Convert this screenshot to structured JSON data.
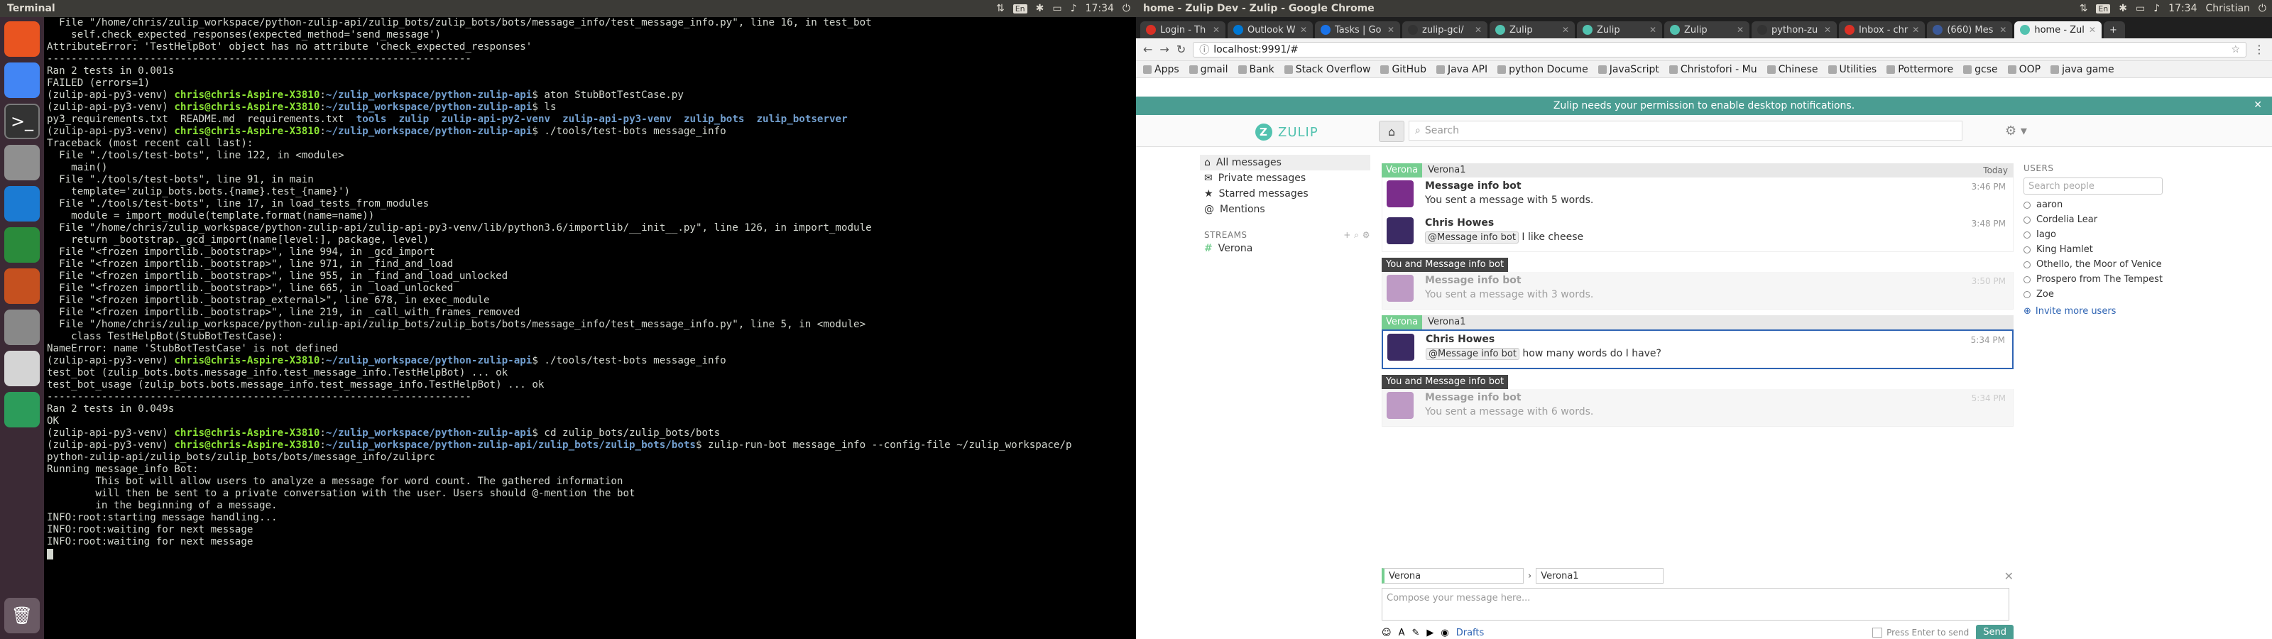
{
  "left_screen": {
    "topbar": {
      "title": "Terminal",
      "time": "17:34",
      "icons": [
        "network-icon",
        "keyboard-icon",
        "bluetooth-icon",
        "battery-icon",
        "volume-icon"
      ],
      "keyboard_label": "En"
    },
    "launcher": [
      {
        "name": "dash-icon",
        "color": "#e95420"
      },
      {
        "name": "chrome-icon",
        "color": "#4285f4"
      },
      {
        "name": "terminal-icon",
        "color": "#333333"
      },
      {
        "name": "files-icon",
        "color": "#8f8f8f"
      },
      {
        "name": "writer-icon",
        "color": "#1b7bd3"
      },
      {
        "name": "calc-icon",
        "color": "#2a8b3b"
      },
      {
        "name": "impress-icon",
        "color": "#c5501f"
      },
      {
        "name": "settings-icon",
        "color": "#888888"
      },
      {
        "name": "app-icon",
        "color": "#d4d4d4"
      },
      {
        "name": "green-app-icon",
        "color": "#2c9c5a"
      }
    ],
    "terminal_lines": [
      {
        "t": "  File \"/home/chris/zulip_workspace/python-zulip-api/zulip_bots/zulip_bots/bots/message_info/test_message_info.py\", line 16, in test_bot"
      },
      {
        "t": "    self.check_expected_responses(expected_method='send_message')"
      },
      {
        "t": "AttributeError: 'TestHelpBot' object has no attribute 'check_expected_responses'"
      },
      {
        "t": ""
      },
      {
        "t": "----------------------------------------------------------------------"
      },
      {
        "t": "Ran 2 tests in 0.001s"
      },
      {
        "t": ""
      },
      {
        "t": "FAILED (errors=1)"
      },
      {
        "p": "(zulip-api-py3-venv) ",
        "u": "chris@chris-Aspire-X3810",
        "c": ":",
        "d": "~/zulip_workspace/python-zulip-api",
        "cmd": "$ aton StubBotTestCase.py"
      },
      {
        "p": "(zulip-api-py3-venv) ",
        "u": "chris@chris-Aspire-X3810",
        "c": ":",
        "d": "~/zulip_workspace/python-zulip-api",
        "cmd": "$ ls"
      },
      {
        "t": "py3_requirements.txt  README.md  requirements.txt  tools  zulip  zulip-api-py2-venv  zulip-api-py3-venv  zulip_bots  zulip_botserver"
      },
      {
        "p": "(zulip-api-py3-venv) ",
        "u": "chris@chris-Aspire-X3810",
        "c": ":",
        "d": "~/zulip_workspace/python-zulip-api",
        "cmd": "$ ./tools/test-bots message_info"
      },
      {
        "t": "Traceback (most recent call last):"
      },
      {
        "t": "  File \"./tools/test-bots\", line 122, in <module>"
      },
      {
        "t": "    main()"
      },
      {
        "t": "  File \"./tools/test-bots\", line 91, in main"
      },
      {
        "t": "    template='zulip_bots.bots.{name}.test_{name}')"
      },
      {
        "t": "  File \"./tools/test-bots\", line 17, in load_tests_from_modules"
      },
      {
        "t": "    module = import_module(template.format(name=name))"
      },
      {
        "t": "  File \"/home/chris/zulip_workspace/python-zulip-api/zulip-api-py3-venv/lib/python3.6/importlib/__init__.py\", line 126, in import_module"
      },
      {
        "t": "    return _bootstrap._gcd_import(name[level:], package, level)"
      },
      {
        "t": "  File \"<frozen importlib._bootstrap>\", line 994, in _gcd_import"
      },
      {
        "t": "  File \"<frozen importlib._bootstrap>\", line 971, in _find_and_load"
      },
      {
        "t": "  File \"<frozen importlib._bootstrap>\", line 955, in _find_and_load_unlocked"
      },
      {
        "t": "  File \"<frozen importlib._bootstrap>\", line 665, in _load_unlocked"
      },
      {
        "t": "  File \"<frozen importlib._bootstrap_external>\", line 678, in exec_module"
      },
      {
        "t": "  File \"<frozen importlib._bootstrap>\", line 219, in _call_with_frames_removed"
      },
      {
        "t": "  File \"/home/chris/zulip_workspace/python-zulip-api/zulip_bots/zulip_bots/bots/message_info/test_message_info.py\", line 5, in <module>"
      },
      {
        "t": "    class TestHelpBot(StubBotTestCase):"
      },
      {
        "t": "NameError: name 'StubBotTestCase' is not defined"
      },
      {
        "p": "(zulip-api-py3-venv) ",
        "u": "chris@chris-Aspire-X3810",
        "c": ":",
        "d": "~/zulip_workspace/python-zulip-api",
        "cmd": "$ ./tools/test-bots message_info"
      },
      {
        "t": "test_bot (zulip_bots.bots.message_info.test_message_info.TestHelpBot) ... ok"
      },
      {
        "t": "test_bot_usage (zulip_bots.bots.message_info.test_message_info.TestHelpBot) ... ok"
      },
      {
        "t": ""
      },
      {
        "t": "----------------------------------------------------------------------"
      },
      {
        "t": "Ran 2 tests in 0.049s"
      },
      {
        "t": ""
      },
      {
        "t": "OK"
      },
      {
        "p": "(zulip-api-py3-venv) ",
        "u": "chris@chris-Aspire-X3810",
        "c": ":",
        "d": "~/zulip_workspace/python-zulip-api",
        "cmd": "$ cd zulip_bots/zulip_bots/bots"
      },
      {
        "p": "(zulip-api-py3-venv) ",
        "u": "chris@chris-Aspire-X3810",
        "c": ":",
        "d": "~/zulip_workspace/python-zulip-api/zulip_bots/zulip_bots/bots",
        "cmd": "$ zulip-run-bot message_info --config-file ~/zulip_workspace/p"
      },
      {
        "t": "python-zulip-api/zulip_bots/zulip_bots/bots/message_info/zuliprc"
      },
      {
        "t": "Running message_info Bot:"
      },
      {
        "t": ""
      },
      {
        "t": "        This bot will allow users to analyze a message for word count. The gathered information"
      },
      {
        "t": "        will then be sent to a private conversation with the user. Users should @-mention the bot"
      },
      {
        "t": "        in the beginning of a message."
      },
      {
        "t": ""
      },
      {
        "t": "INFO:root:starting message handling..."
      },
      {
        "t": "INFO:root:waiting for next message"
      },
      {
        "t": "INFO:root:waiting for next message"
      }
    ]
  },
  "right_screen": {
    "topbar": {
      "title": "home - Zulip Dev - Zulip - Google Chrome",
      "time": "17:34",
      "user": "Christian",
      "keyboard_label": "En"
    },
    "tabs": [
      {
        "label": "Login - Th",
        "color": "#d93025"
      },
      {
        "label": "Outlook W",
        "color": "#0078d4"
      },
      {
        "label": "Tasks | Go",
        "color": "#1a73e8"
      },
      {
        "label": "zulip-gci/",
        "color": "#333333"
      },
      {
        "label": "Zulip",
        "color": "#52c2af"
      },
      {
        "label": "Zulip",
        "color": "#52c2af"
      },
      {
        "label": "Zulip",
        "color": "#52c2af"
      },
      {
        "label": "python-zu",
        "color": "#333333"
      },
      {
        "label": "Inbox - chr",
        "color": "#d93025"
      },
      {
        "label": "(660) Mes",
        "color": "#3b5998"
      },
      {
        "label": "home - Zul",
        "color": "#52c2af",
        "active": true
      }
    ],
    "url": "localhost:9991/#",
    "bookmarks": [
      "Apps",
      "gmail",
      "Bank",
      "Stack Overflow",
      "GitHub",
      "Java API",
      "python Docume",
      "JavaScript",
      "Christofori - Mu",
      "Chinese",
      "Utilities",
      "Pottermore",
      "gcse",
      "OOP",
      "java game"
    ],
    "banner": "Zulip needs your permission to enable desktop notifications.",
    "logo": "ZULIP",
    "search_placeholder": "Search",
    "leftnav": {
      "items": [
        {
          "label": "All messages",
          "icon": "home-icon"
        },
        {
          "label": "Private messages",
          "icon": "envelope-icon"
        },
        {
          "label": "Starred messages",
          "icon": "star-icon"
        },
        {
          "label": "Mentions",
          "icon": "at-icon"
        }
      ],
      "streams_header": "STREAMS",
      "streams": [
        "Verona"
      ]
    },
    "messages": {
      "stream": "Verona",
      "topic": "Verona1",
      "date": "Today",
      "pm_label": "You and Message info bot",
      "groups": [
        {
          "type": "stream",
          "msgs": [
            {
              "sender": "Message info bot",
              "time": "3:46 PM",
              "mention": "",
              "text": "You sent a message with 5 words."
            },
            {
              "sender": "Chris Howes",
              "time": "3:48 PM",
              "mention": "@Message info bot",
              "text": " I like cheese"
            }
          ]
        },
        {
          "type": "pm",
          "msgs": [
            {
              "sender": "Message info bot",
              "time": "3:50 PM",
              "mention": "",
              "text": "You sent a message with 3 words."
            }
          ]
        },
        {
          "type": "stream",
          "selected": true,
          "msgs": [
            {
              "sender": "Chris Howes",
              "time": "5:34 PM",
              "mention": "@Message info bot",
              "text": " how many words do I have?"
            }
          ]
        },
        {
          "type": "pm",
          "msgs": [
            {
              "sender": "Message info bot",
              "time": "5:34 PM",
              "mention": "",
              "text": "You sent a message with 6 words."
            }
          ]
        }
      ]
    },
    "users": {
      "header": "USERS",
      "search_placeholder": "Search people",
      "list": [
        "aaron",
        "Cordelia Lear",
        "Iago",
        "King Hamlet",
        "Othello, the Moor of Venice",
        "Prospero from The Tempest",
        "Zoe"
      ],
      "invite": "Invite more users"
    },
    "compose": {
      "stream": "Verona",
      "topic": "Verona1",
      "placeholder": "Compose your message here...",
      "drafts": "Drafts",
      "press_enter": "Press Enter to send",
      "send": "Send"
    }
  }
}
